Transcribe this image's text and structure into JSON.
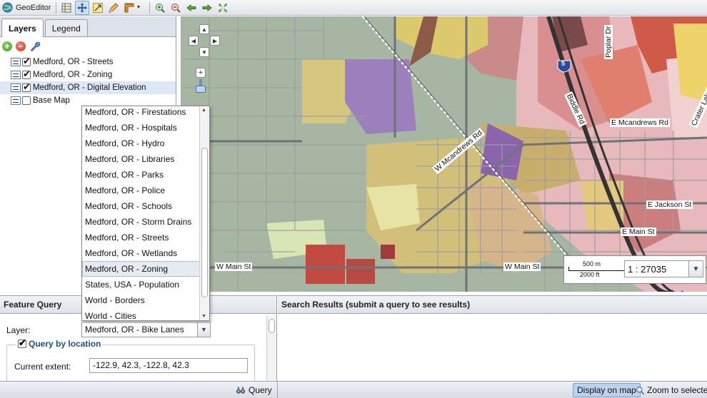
{
  "app": {
    "title": "GeoEditor"
  },
  "toolbar": {
    "buttons": [
      "select-features",
      "pan",
      "zoom-box",
      "edit",
      "measure"
    ],
    "nav": [
      "zoom-in",
      "zoom-out",
      "back",
      "forward",
      "full-extent"
    ]
  },
  "left_panel": {
    "tabs": [
      {
        "label": "Layers",
        "active": true
      },
      {
        "label": "Legend",
        "active": false
      }
    ],
    "layers": [
      {
        "label": "Medford, OR - Streets",
        "checked": true,
        "selected": false
      },
      {
        "label": "Medford, OR - Zoning",
        "checked": true,
        "selected": false
      },
      {
        "label": "Medford, OR - Digital Elevation",
        "checked": true,
        "selected": true
      },
      {
        "label": "Base Map",
        "checked": false,
        "selected": false
      }
    ]
  },
  "map": {
    "street_labels": {
      "w_mcandrews": "W Mcandrews Rd",
      "e_mcandrews": "E Mcandrews Rd",
      "biddle": "Biddle Rd",
      "poplar": "Poplar Dr",
      "crater": "Crater Lake",
      "e_jackson": "E Jackson St",
      "e_main": "E Main St",
      "w_main_1": "W Main St",
      "w_main_2": "W Main St",
      "interstate": "5"
    },
    "scale": {
      "meters": "500 m",
      "feet": "2000 ft",
      "ratio": "1 : 27035"
    }
  },
  "dropdown": {
    "items": [
      "Medford, OR - Firestations",
      "Medford, OR - Hospitals",
      "Medford, OR - Hydro",
      "Medford, OR - Libraries",
      "Medford, OR - Parks",
      "Medford, OR - Police",
      "Medford, OR - Schools",
      "Medford, OR - Storm Drains",
      "Medford, OR - Streets",
      "Medford, OR - Wetlands",
      "Medford, OR - Zoning",
      "States, USA - Population",
      "World - Borders",
      "World - Cities"
    ],
    "highlighted_index": 10
  },
  "feature_query": {
    "title": "Feature Query",
    "layer_label": "Layer:",
    "layer_value": "Medford, OR - Bike Lanes",
    "query_by_location_label": "Query by location",
    "query_by_location_checked": true,
    "current_extent_label": "Current extent:",
    "current_extent_value": "-122.9, 42.3, -122.8, 42.3",
    "query_button": "Query"
  },
  "search_results": {
    "title": "Search Results (submit a query to see results)",
    "display_button": "Display on map",
    "zoom_button": "Zoom to selected"
  }
}
